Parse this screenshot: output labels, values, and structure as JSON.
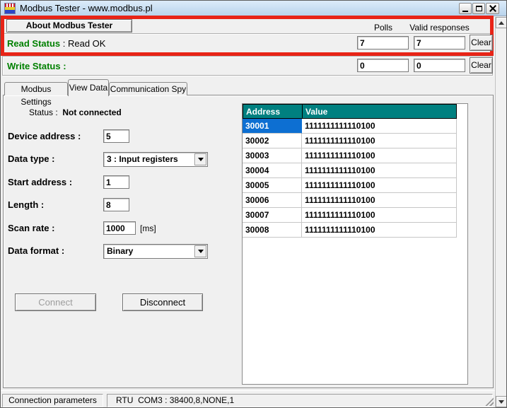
{
  "titlebar": {
    "title": "Modbus Tester - www.modbus.pl"
  },
  "about": {
    "label": "About Modbus Tester"
  },
  "counters": {
    "polls_label": "Polls",
    "valid_label": "Valid responses"
  },
  "read": {
    "label": "Read Status",
    "status_text": " : Read OK",
    "polls": "7",
    "valid": "7",
    "clear": "Clear"
  },
  "write": {
    "label": "Write Status :",
    "polls": "0",
    "valid": "0",
    "clear": "Clear"
  },
  "tabs": {
    "settings": "Modbus Settings",
    "view_data": "View Data",
    "comm_spy": "Communication Spy"
  },
  "form": {
    "status_label": "Status :  ",
    "status_value": "Not connected",
    "device_label": "Device address :",
    "device_value": "5",
    "datatype_label": "Data type :",
    "datatype_value": "3 : Input registers",
    "start_label": "Start address :",
    "start_value": "1",
    "length_label": "Length :",
    "length_value": "8",
    "scan_label": "Scan rate :",
    "scan_value": "1000",
    "scan_unit": "[ms]",
    "format_label": "Data format :",
    "format_value": "Binary",
    "connect": "Connect",
    "disconnect": "Disconnect"
  },
  "grid": {
    "headers": [
      "Address",
      "Value"
    ],
    "rows": [
      {
        "address": "30001",
        "value": "1111111111110100"
      },
      {
        "address": "30002",
        "value": "1111111111110100"
      },
      {
        "address": "30003",
        "value": "1111111111110100"
      },
      {
        "address": "30004",
        "value": "1111111111110100"
      },
      {
        "address": "30005",
        "value": "1111111111110100"
      },
      {
        "address": "30006",
        "value": "1111111111110100"
      },
      {
        "address": "30007",
        "value": "1111111111110100"
      },
      {
        "address": "30008",
        "value": "1111111111110100"
      }
    ]
  },
  "statusbar": {
    "left": "Connection parameters",
    "right": "RTU  COM3 : 38400,8,NONE,1"
  },
  "colors": {
    "highlight_red": "#e82417",
    "status_green": "#008000",
    "header_teal": "#008080",
    "selected_blue": "#0d6fd2",
    "titlebar_blue": "#b9d4ec"
  }
}
